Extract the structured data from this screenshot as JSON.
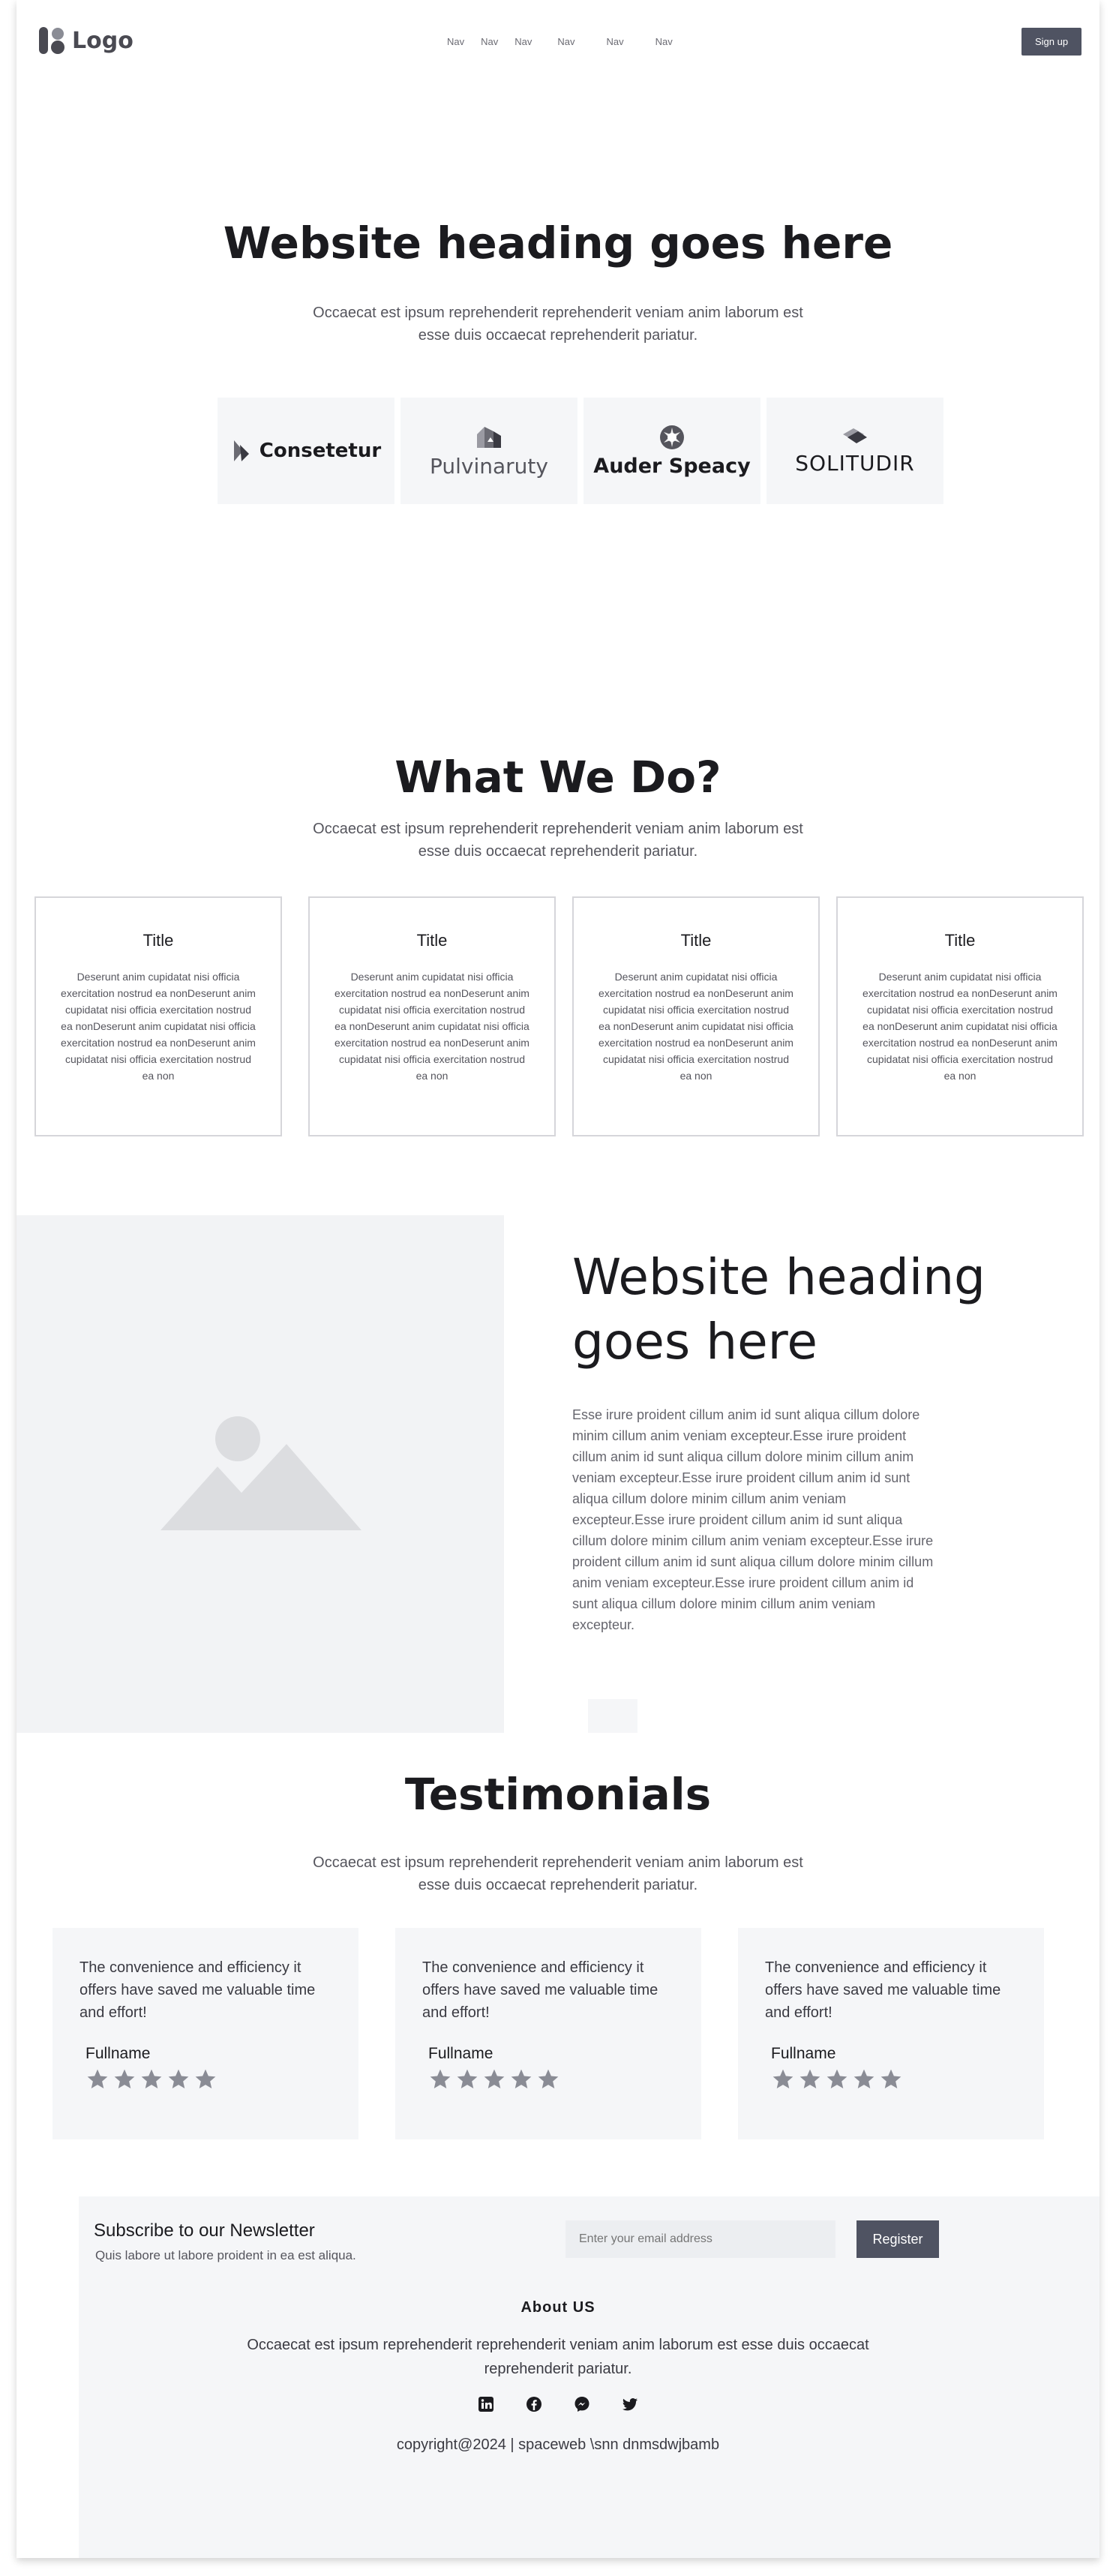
{
  "header": {
    "logo_text": "Logo",
    "nav_items": [
      "Nav",
      "Nav",
      "Nav",
      "Nav",
      "Nav",
      "Nav"
    ],
    "signup_label": "Sign up"
  },
  "hero": {
    "title": "Website heading goes here",
    "subtitle_line1": "Occaecat est ipsum reprehenderit reprehenderit veniam anim laborum est",
    "subtitle_line2": "esse duis occaecat reprehenderit pariatur.",
    "brands": [
      "Consetetur",
      "Pulvinaruty",
      "Auder Speacy",
      "SOLITUDIR"
    ]
  },
  "services": {
    "title": "What We Do?",
    "subtitle_line1": "Occaecat est ipsum reprehenderit reprehenderit veniam anim laborum est",
    "subtitle_line2": "esse duis occaecat reprehenderit pariatur.",
    "cards": [
      {
        "title": "Title",
        "body": "Deserunt anim cupidatat nisi officia exercitation nostrud ea nonDeserunt anim cupidatat nisi officia exercitation nostrud ea nonDeserunt anim cupidatat nisi officia exercitation nostrud ea nonDeserunt anim cupidatat nisi officia exercitation nostrud ea non"
      },
      {
        "title": "Title",
        "body": "Deserunt anim cupidatat nisi officia exercitation nostrud ea nonDeserunt anim cupidatat nisi officia exercitation nostrud ea nonDeserunt anim cupidatat nisi officia exercitation nostrud ea nonDeserunt anim cupidatat nisi officia exercitation nostrud ea non"
      },
      {
        "title": "Title",
        "body": "Deserunt anim cupidatat nisi officia exercitation nostrud ea nonDeserunt anim cupidatat nisi officia exercitation nostrud ea nonDeserunt anim cupidatat nisi officia exercitation nostrud ea nonDeserunt anim cupidatat nisi officia exercitation nostrud ea non"
      },
      {
        "title": "Title",
        "body": "Deserunt anim cupidatat nisi officia exercitation nostrud ea nonDeserunt anim cupidatat nisi officia exercitation nostrud ea nonDeserunt anim cupidatat nisi officia exercitation nostrud ea nonDeserunt anim cupidatat nisi officia exercitation nostrud ea non"
      }
    ]
  },
  "feature": {
    "title": "Website heading goes here",
    "body": "Esse irure proident cillum anim id sunt aliqua cillum dolore minim cillum anim veniam excepteur.Esse irure proident cillum anim id sunt aliqua cillum dolore minim cillum anim veniam excepteur.Esse irure proident cillum anim id sunt aliqua cillum dolore minim cillum anim veniam excepteur.Esse irure proident cillum anim id sunt aliqua cillum dolore minim cillum anim veniam excepteur.Esse irure proident cillum anim id sunt aliqua cillum dolore minim cillum anim veniam excepteur.Esse irure proident cillum anim id sunt aliqua cillum dolore minim cillum anim veniam excepteur."
  },
  "testimonials": {
    "title": "Testimonials",
    "subtitle_line1": "Occaecat est ipsum reprehenderit reprehenderit veniam anim laborum est",
    "subtitle_line2": "esse duis occaecat reprehenderit pariatur.",
    "items": [
      {
        "quote": "The convenience and efficiency it offers have saved me valuable time and effort!",
        "name": "Fullname",
        "rating": 5
      },
      {
        "quote": "The convenience and efficiency it offers have saved me valuable time and effort!",
        "name": "Fullname",
        "rating": 5
      },
      {
        "quote": "The convenience and efficiency it offers have saved me valuable time and effort!",
        "name": "Fullname",
        "rating": 5
      }
    ]
  },
  "newsletter": {
    "title": "Subscribe to our Newsletter",
    "subtitle": "Quis labore ut labore proident in ea est aliqua.",
    "email_placeholder": "Enter your email address",
    "register_label": "Register"
  },
  "footer": {
    "about_title": "About US",
    "about_line1": "Occaecat est ipsum reprehenderit reprehenderit veniam anim laborum est esse duis occaecat",
    "about_line2": "reprehenderit pariatur.",
    "socials": [
      "linkedin-icon",
      "facebook-icon",
      "messenger-icon",
      "twitter-icon"
    ],
    "copyright": "copyright@2024 | spaceweb \\snn dnmsdwjbamb"
  },
  "colors": {
    "primary_button": "#4f5362",
    "panel_bg": "#f5f6f8",
    "star": "#8a8c95"
  }
}
